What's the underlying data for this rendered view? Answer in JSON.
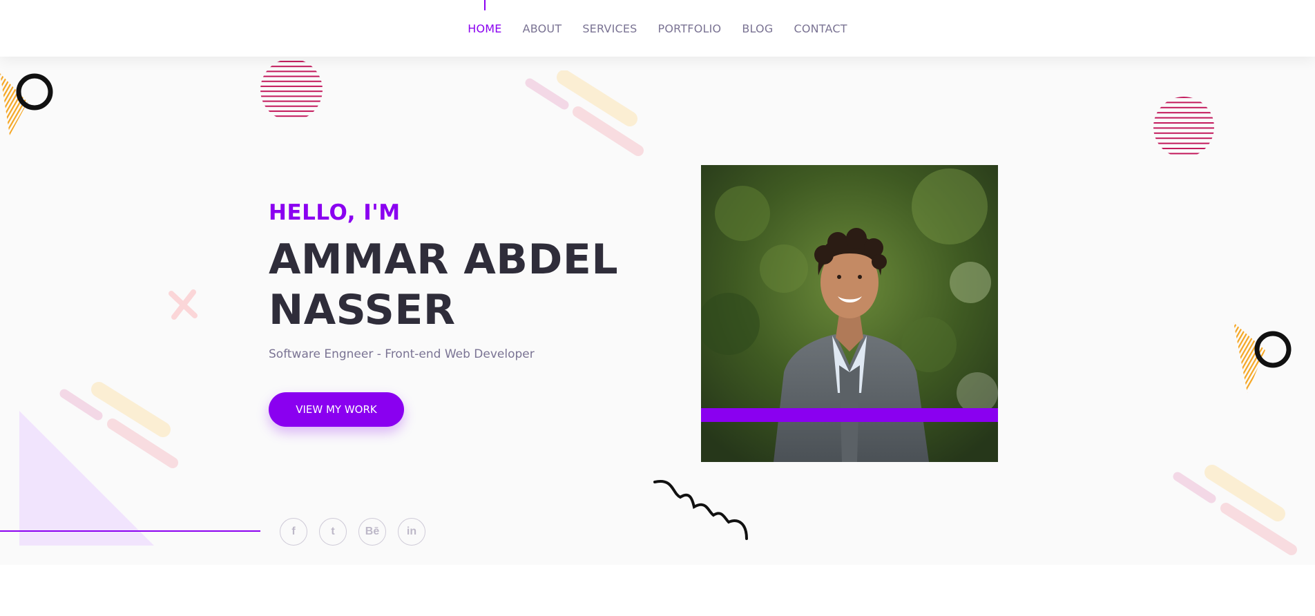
{
  "nav": {
    "items": [
      {
        "label": "HOME",
        "active": true
      },
      {
        "label": "ABOUT",
        "active": false
      },
      {
        "label": "SERVICES",
        "active": false
      },
      {
        "label": "PORTFOLIO",
        "active": false
      },
      {
        "label": "BLOG",
        "active": false
      },
      {
        "label": "CONTACT",
        "active": false
      }
    ]
  },
  "hero": {
    "greeting": "HELLO, I'M",
    "name_line1": "AMMAR ABDEL",
    "name_line2": "NASSER",
    "subtitle": "Software Engneer - Front-end Web Developer",
    "cta_label": "VIEW MY WORK"
  },
  "social": [
    {
      "icon": "facebook-icon",
      "glyph": "f"
    },
    {
      "icon": "twitter-icon",
      "glyph": "t"
    },
    {
      "icon": "behance-icon",
      "glyph": "Bē"
    },
    {
      "icon": "linkedin-icon",
      "glyph": "in"
    }
  ],
  "colors": {
    "accent": "#8a00f0",
    "heading": "#2f2d3a",
    "muted": "#7a7393",
    "stripe_circle": "#c2185b",
    "yellow_triangle": "#f5a623",
    "lavender": "#f1e4fd"
  }
}
